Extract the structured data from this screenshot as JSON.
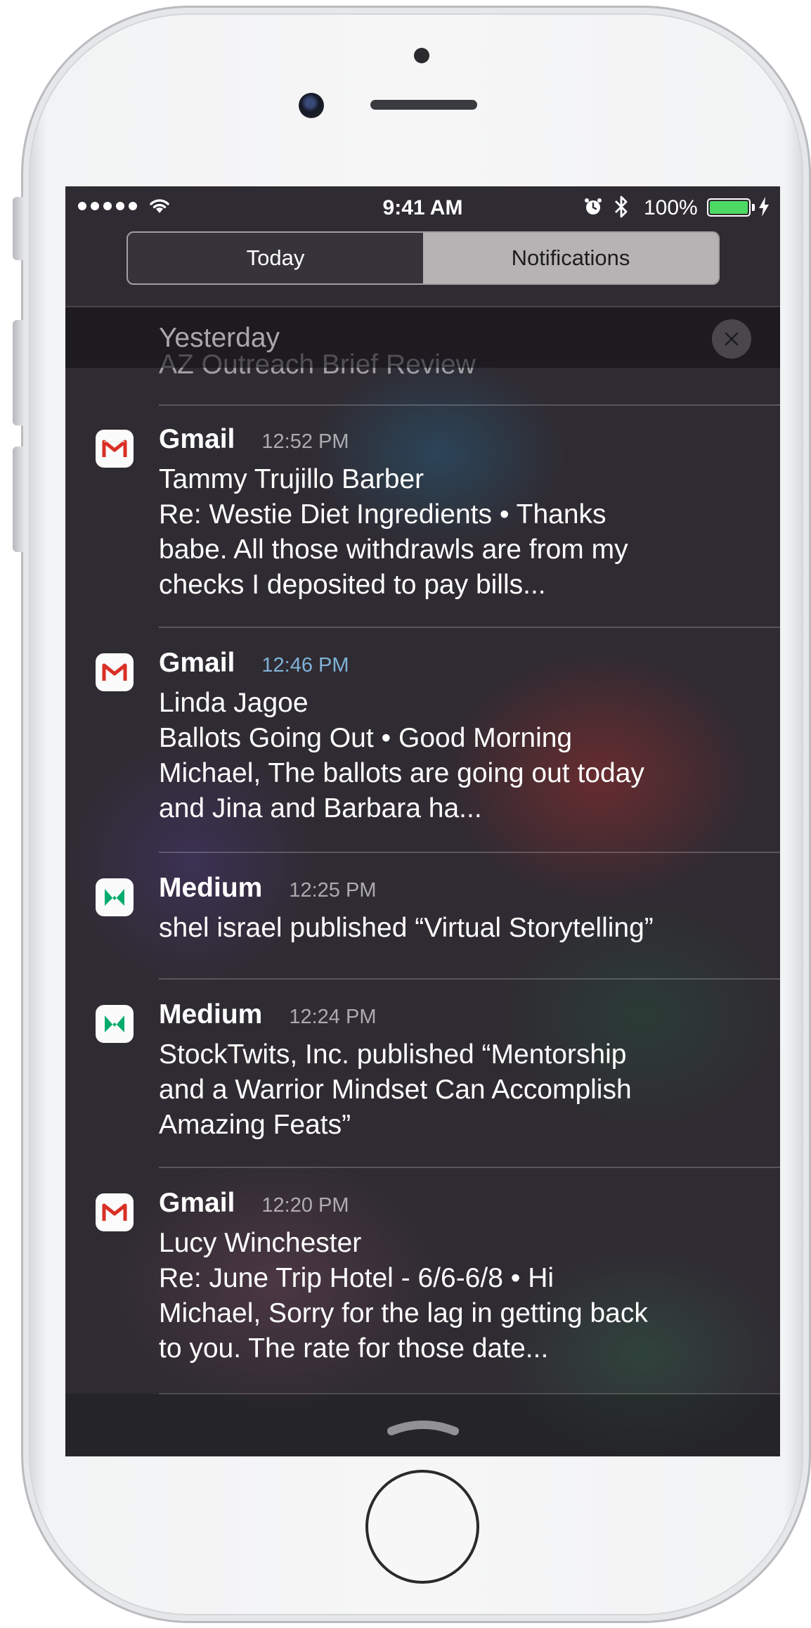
{
  "status_bar": {
    "time": "9:41 AM",
    "battery_percent": "100%",
    "battery_level": 1.0,
    "signal_bars": 5,
    "icons": [
      "signal-dots-icon",
      "wifi-icon",
      "alarm-icon",
      "bluetooth-icon",
      "battery-icon",
      "charging-icon"
    ]
  },
  "segmented": {
    "tabs": [
      {
        "label": "Today",
        "selected": false
      },
      {
        "label": "Notifications",
        "selected": true
      }
    ]
  },
  "section": {
    "title": "Yesterday",
    "clear_icon": "close-icon"
  },
  "clipped_notification": {
    "text": "AZ Outreach Brief Review"
  },
  "notifications": [
    {
      "app": "Gmail",
      "time": "12:52 PM",
      "icon": "gmail-icon",
      "lines": [
        "Tammy Trujillo Barber",
        "Re: Westie Diet Ingredients  •  Thanks",
        "babe. All those withdrawls are from my",
        "checks I deposited to pay bills..."
      ]
    },
    {
      "app": "Gmail",
      "time": "12:46 PM",
      "icon": "gmail-icon",
      "lines": [
        "Linda Jagoe",
        "Ballots Going Out  •  Good Morning",
        "Michael, The ballots are going out today",
        "and Jina and Barbara ha..."
      ]
    },
    {
      "app": "Medium",
      "time": "12:25 PM",
      "icon": "medium-icon",
      "lines": [
        "shel israel published “Virtual Storytelling”"
      ]
    },
    {
      "app": "Medium",
      "time": "12:24 PM",
      "icon": "medium-icon",
      "lines": [
        "StockTwits, Inc. published “Mentorship",
        "and a Warrior Mindset Can Accomplish",
        "Amazing Feats”"
      ]
    },
    {
      "app": "Gmail",
      "time": "12:20 PM",
      "icon": "gmail-icon",
      "lines": [
        "Lucy Winchester",
        "Re: June Trip Hotel - 6/6-6/8  •  Hi",
        "Michael, Sorry for the lag in getting back",
        "to you. The rate for those date..."
      ]
    }
  ],
  "colors": {
    "battery_green": "#4cd964",
    "gmail_red": "#d93025",
    "medium_green": "#00ab6c",
    "highlight_time": "#7fb2d8"
  }
}
